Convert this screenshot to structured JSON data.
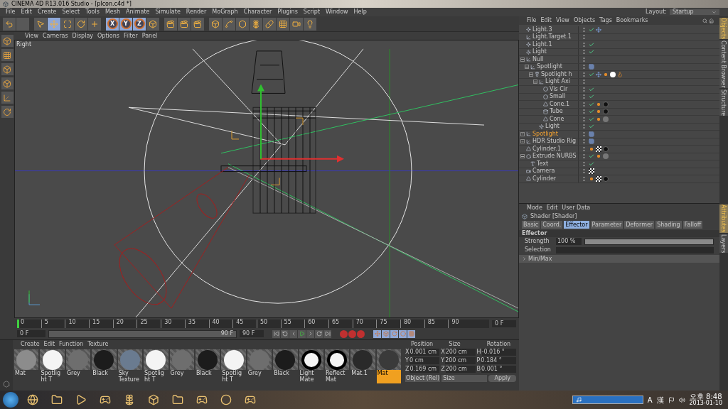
{
  "window": {
    "title": "CINEMA 4D R13.016 Studio - [plcon.c4d *]"
  },
  "menu": [
    "File",
    "Edit",
    "Create",
    "Select",
    "Tools",
    "Mesh",
    "Animate",
    "Simulate",
    "Render",
    "MoGraph",
    "Character",
    "Plugins",
    "Script",
    "Window",
    "Help"
  ],
  "layout": {
    "label": "Layout:",
    "value": "Startup"
  },
  "toolbar": [
    {
      "kind": "undo",
      "selected": false
    },
    {
      "kind": "blank",
      "selected": false
    },
    {
      "kind": "select",
      "selected": false
    },
    {
      "kind": "move",
      "selected": true
    },
    {
      "kind": "scale",
      "selected": false
    },
    {
      "kind": "rotate",
      "selected": false
    },
    {
      "kind": "add",
      "selected": false
    },
    {
      "kind": "axis",
      "label": "X",
      "selected": true
    },
    {
      "kind": "axis",
      "label": "Y",
      "selected": true
    },
    {
      "kind": "axis",
      "label": "Z",
      "selected": true
    },
    {
      "kind": "coord",
      "selected": false
    },
    {
      "kind": "render",
      "selected": false
    },
    {
      "kind": "render",
      "selected": false
    },
    {
      "kind": "render",
      "selected": false
    },
    {
      "kind": "cube",
      "selected": false
    },
    {
      "kind": "spline",
      "selected": false
    },
    {
      "kind": "nurbs",
      "selected": false
    },
    {
      "kind": "array",
      "selected": false
    },
    {
      "kind": "deformer",
      "selected": false
    },
    {
      "kind": "floor",
      "selected": false
    },
    {
      "kind": "camera",
      "selected": false
    },
    {
      "kind": "light",
      "selected": false
    }
  ],
  "viewport": {
    "menu": [
      "View",
      "Cameras",
      "Display",
      "Options",
      "Filter",
      "Panel"
    ],
    "label": "Right"
  },
  "timeline": {
    "ticks": [
      "0",
      "5",
      "10",
      "15",
      "20",
      "25",
      "30",
      "35",
      "40",
      "45",
      "50",
      "55",
      "60",
      "65",
      "70",
      "75",
      "80",
      "85",
      "90"
    ],
    "level": 0,
    "current": "0 F",
    "start": "0 F",
    "range": {
      "label": "90 F",
      "level": 1
    },
    "end": "90 F"
  },
  "materials": {
    "menu": [
      "Create",
      "Edit",
      "Function",
      "Texture"
    ],
    "items": [
      {
        "name": "Mat",
        "kind": "sphere",
        "color": "#8c8c8c",
        "selected": false
      },
      {
        "name": "Spotlight T",
        "kind": "sphere",
        "color": "#f4f4f4",
        "selected": false
      },
      {
        "name": "Grey",
        "kind": "sphere",
        "color": "#6e6e6e",
        "selected": false
      },
      {
        "name": "Black",
        "kind": "sphere",
        "color": "#1c1c1c",
        "selected": false
      },
      {
        "name": "Sky Texture",
        "kind": "sphere",
        "color": "#6a7b90",
        "selected": false
      },
      {
        "name": "Spotlight T",
        "kind": "sphere",
        "color": "#f4f4f4",
        "selected": false
      },
      {
        "name": "Grey",
        "kind": "sphere",
        "color": "#6e6e6e",
        "selected": false
      },
      {
        "name": "Black",
        "kind": "sphere",
        "color": "#1c1c1c",
        "selected": false
      },
      {
        "name": "Spotlight T",
        "kind": "sphere",
        "color": "#f4f4f4",
        "selected": false
      },
      {
        "name": "Grey",
        "kind": "sphere",
        "color": "#6e6e6e",
        "selected": false
      },
      {
        "name": "Black",
        "kind": "sphere",
        "color": "#1c1c1c",
        "selected": false
      },
      {
        "name": "Light Mate",
        "kind": "stripe",
        "color": "#f4f4f4",
        "selected": false
      },
      {
        "name": "Reflect Mat",
        "kind": "stripe",
        "color": "#f4f4f4",
        "selected": false
      },
      {
        "name": "Mat.1",
        "kind": "sphere",
        "color": "#2a2a2a",
        "selected": false
      },
      {
        "name": "Mat",
        "kind": "sphere",
        "color": "#3a3a3a",
        "selected": true
      }
    ]
  },
  "coordinates": {
    "headers": [
      "Position",
      "Size",
      "Rotation"
    ],
    "rows": [
      {
        "axis": "X",
        "position": "0.001 cm",
        "size_axis": "X",
        "size": "200 cm",
        "rot_axis": "H",
        "rotation": "-0.016 °"
      },
      {
        "axis": "Y",
        "position": "0 cm",
        "size_axis": "Y",
        "size": "200 cm",
        "rot_axis": "P",
        "rotation": "0.184 °"
      },
      {
        "axis": "Z",
        "position": "0.169 cm",
        "size_axis": "Z",
        "size": "200 cm",
        "rot_axis": "B",
        "rotation": "0.001 °"
      }
    ],
    "mode": "Object (Rel)",
    "size_mode": "Size",
    "apply": "Apply"
  },
  "objects": {
    "menu": [
      "File",
      "Edit",
      "View",
      "Objects",
      "Tags",
      "Bookmarks"
    ],
    "items": [
      {
        "name": "Light.3",
        "kind": "light",
        "selected": false,
        "tags": [
          {
            "kind": "check"
          },
          {
            "kind": "target"
          }
        ]
      },
      {
        "name": "Light.Target.1",
        "kind": "null",
        "selected": false
      },
      {
        "name": "Light.1",
        "kind": "light",
        "selected": false,
        "tags": [
          {
            "kind": "check"
          }
        ]
      },
      {
        "name": "Light",
        "kind": "light",
        "selected": false,
        "tags": [
          {
            "kind": "check"
          }
        ]
      },
      {
        "name": "Null",
        "kind": "null",
        "selected": false,
        "expanded": true,
        "children": [
          {
            "name": "Spotlight",
            "kind": "null",
            "selected": false,
            "expanded": true,
            "tags": [
              {
                "kind": "xpresso"
              }
            ],
            "children": [
              {
                "name": "Spotlight h",
                "kind": "spot",
                "selected": false,
                "expanded": true,
                "tags": [
                  {
                    "kind": "check"
                  },
                  {
                    "kind": "target"
                  },
                  {
                    "kind": "phong"
                  },
                  {
                    "kind": "white"
                  },
                  {
                    "kind": "flame"
                  }
                ],
                "children": [
                  {
                    "name": "Light Axi",
                    "kind": "null",
                    "selected": false,
                    "expanded": true,
                    "children": [
                      {
                        "name": "Vis Cir",
                        "kind": "circle",
                        "selected": false,
                        "tags": [
                          {
                            "kind": "check"
                          }
                        ]
                      },
                      {
                        "name": "Small",
                        "kind": "circle",
                        "selected": false,
                        "tags": [
                          {
                            "kind": "check"
                          }
                        ]
                      },
                      {
                        "name": "Cone.1",
                        "kind": "cone",
                        "selected": false,
                        "tags": [
                          {
                            "kind": "check"
                          },
                          {
                            "kind": "phong"
                          },
                          {
                            "kind": "dark"
                          }
                        ]
                      },
                      {
                        "name": "Tube",
                        "kind": "tube",
                        "selected": false,
                        "tags": [
                          {
                            "kind": "check"
                          },
                          {
                            "kind": "phong"
                          },
                          {
                            "kind": "dark"
                          }
                        ]
                      },
                      {
                        "name": "Cone",
                        "kind": "cone",
                        "selected": false,
                        "tags": [
                          {
                            "kind": "check"
                          },
                          {
                            "kind": "phong"
                          },
                          {
                            "kind": "grey"
                          }
                        ]
                      }
                    ]
                  },
                  {
                    "name": "Light",
                    "kind": "light",
                    "selected": false,
                    "tags": [
                      {
                        "kind": "check"
                      }
                    ]
                  }
                ]
              }
            ]
          }
        ]
      },
      {
        "name": "Spotlight",
        "kind": "null",
        "selected": true,
        "expanded": false,
        "tags": [
          {
            "kind": "xpresso"
          }
        ]
      },
      {
        "name": "HDR Studio Rig",
        "kind": "null",
        "selected": false,
        "expanded": false,
        "tags": [
          {
            "kind": "xpresso"
          }
        ]
      },
      {
        "name": "Cylinder.1",
        "kind": "cone",
        "selected": false,
        "tags": [
          {
            "kind": "phong"
          },
          {
            "kind": "checker"
          },
          {
            "kind": "dark"
          }
        ]
      },
      {
        "name": "Extrude NURBS",
        "kind": "extrude",
        "selected": false,
        "expanded": true,
        "tags": [
          {
            "kind": "check"
          },
          {
            "kind": "phong"
          },
          {
            "kind": "grey"
          }
        ],
        "children": [
          {
            "name": "Text",
            "kind": "text",
            "selected": false,
            "tags": [
              {
                "kind": "check"
              }
            ]
          }
        ]
      },
      {
        "name": "Camera",
        "kind": "camera",
        "selected": false,
        "tags": [
          {
            "kind": "checker"
          }
        ]
      },
      {
        "name": "Cylinder",
        "kind": "cone",
        "selected": false,
        "tags": [
          {
            "kind": "phong"
          },
          {
            "kind": "checker"
          },
          {
            "kind": "dark"
          }
        ]
      }
    ]
  },
  "attributes": {
    "menu": [
      "Mode",
      "Edit",
      "User Data"
    ],
    "title": "Shader [Shader]",
    "tabs": [
      {
        "label": "Basic",
        "selected": false
      },
      {
        "label": "Coord.",
        "selected": false
      },
      {
        "label": "Effector",
        "selected": true
      },
      {
        "label": "Parameter",
        "selected": false
      },
      {
        "label": "Deformer",
        "selected": false
      },
      {
        "label": "Shading",
        "selected": false
      },
      {
        "label": "Falloff",
        "selected": false
      }
    ],
    "section": "Effector",
    "fields": [
      {
        "kind": "slider",
        "label": "Strength",
        "value": "100 %",
        "level": 1
      },
      {
        "kind": "text",
        "label": "Selection"
      }
    ],
    "group": "Min/Max"
  },
  "side_tabs": {
    "top": [
      {
        "label": "Objects",
        "selected": true
      },
      {
        "label": "Content Browser",
        "selected": false
      },
      {
        "label": "Structure",
        "selected": false
      }
    ],
    "bottom": [
      {
        "label": "Attributes",
        "selected": true
      },
      {
        "label": "Layers",
        "selected": false
      }
    ]
  },
  "taskbar": {
    "ime": [
      "A",
      "漢"
    ],
    "time": "오후 8:48",
    "date": "2013-01-10"
  }
}
